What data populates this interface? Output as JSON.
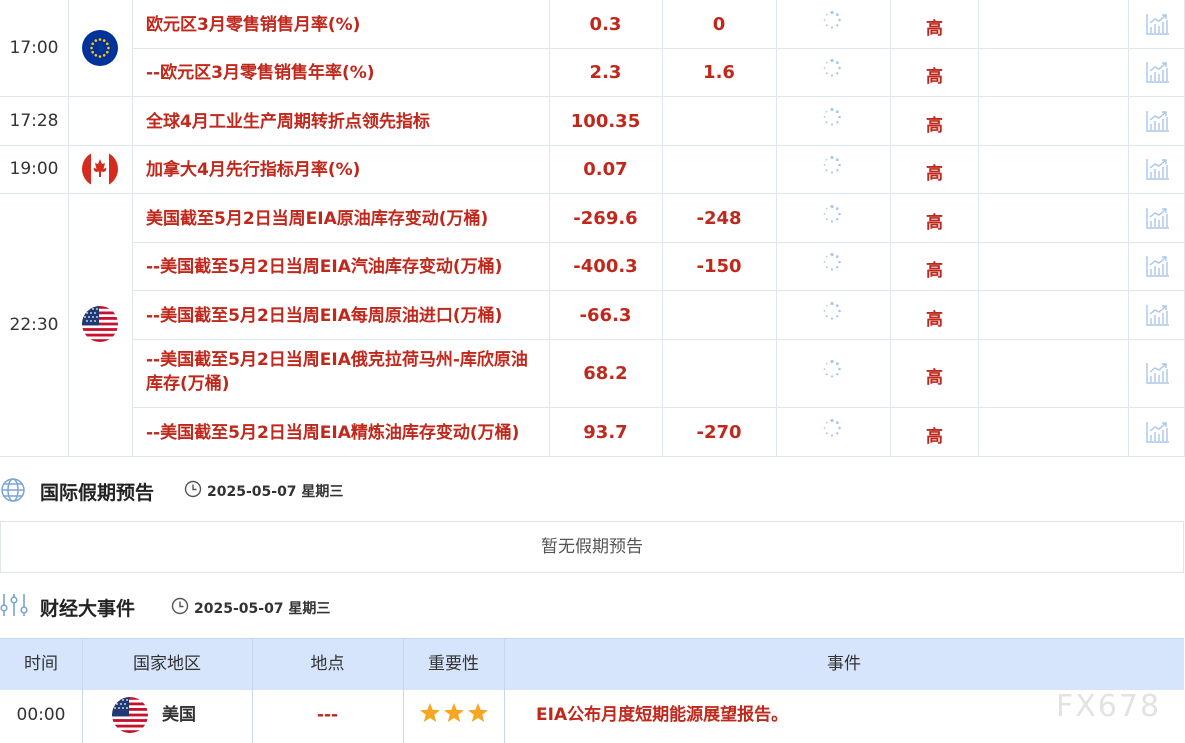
{
  "calendar": {
    "rows": [
      {
        "time": "17:00",
        "country": "eu",
        "indicator": "欧元区3月零售销售月率(%)",
        "actual": "0.3",
        "forecast": "0",
        "importance": "高"
      },
      {
        "time": "",
        "country": "eu",
        "indicator": "--欧元区3月零售销售年率(%)",
        "actual": "2.3",
        "forecast": "1.6",
        "importance": "高"
      },
      {
        "time": "17:28",
        "country": "",
        "indicator": "全球4月工业生产周期转折点领先指标",
        "actual": "100.35",
        "forecast": "",
        "importance": "高"
      },
      {
        "time": "19:00",
        "country": "ca",
        "indicator": "加拿大4月先行指标月率(%)",
        "actual": "0.07",
        "forecast": "",
        "importance": "高"
      },
      {
        "time": "22:30",
        "country": "us",
        "indicator": "美国截至5月2日当周EIA原油库存变动(万桶)",
        "actual": "-269.6",
        "forecast": "-248",
        "importance": "高"
      },
      {
        "time": "",
        "country": "us",
        "indicator": "--美国截至5月2日当周EIA汽油库存变动(万桶)",
        "actual": "-400.3",
        "forecast": "-150",
        "importance": "高"
      },
      {
        "time": "",
        "country": "us",
        "indicator": "--美国截至5月2日当周EIA每周原油进口(万桶)",
        "actual": "-66.3",
        "forecast": "",
        "importance": "高"
      },
      {
        "time": "",
        "country": "us",
        "indicator_line1": "--美国截至5月2日当周EIA俄克拉荷马州-库欣原油",
        "indicator_line2": "库存(万桶)",
        "actual": "68.2",
        "forecast": "",
        "importance": "高"
      },
      {
        "time": "",
        "country": "us",
        "indicator": "--美国截至5月2日当周EIA精炼油库存变动(万桶)",
        "actual": "93.7",
        "forecast": "-270",
        "importance": "高"
      }
    ]
  },
  "holidays": {
    "title": "国际假期预告",
    "date": "2025-05-07 星期三",
    "empty_text": "暂无假期预告"
  },
  "events": {
    "title": "财经大事件",
    "date": "2025-05-07 星期三",
    "headers": [
      "时间",
      "国家地区",
      "地点",
      "重要性",
      "事件"
    ],
    "rows": [
      {
        "time": "00:00",
        "country": "美国",
        "location": "---",
        "stars": 3,
        "event": "EIA公布月度短期能源展望报告。"
      }
    ]
  },
  "watermark": "FX678",
  "colors": {
    "accent_red": "#c0281c",
    "header_bg": "#d6e5fb",
    "star": "#f5a623",
    "grid": "#dfe6ef"
  }
}
